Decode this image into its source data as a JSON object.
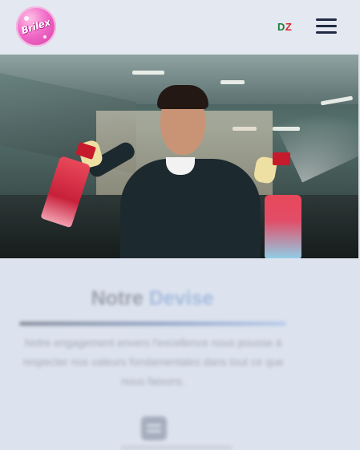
{
  "header": {
    "logo_text": "Brilex",
    "region": {
      "first": "D",
      "second": "Z"
    },
    "menu_icon": "hamburger-menu-icon"
  },
  "hero": {
    "image_alt": "Chef holding two Brilex spray bottles in a kitchen"
  },
  "section": {
    "title_main": "Notre",
    "title_accent": "Devise",
    "text": "Notre engagement envers l'excellence nous pousse à respecter nos valeurs fondamentales dans tout ce que nous faisons.",
    "feature_icon": "card-icon"
  },
  "colors": {
    "region_d": "#1b7f3a",
    "region_z": "#d8262c",
    "menu": "#1f2a44",
    "logo_pink": "#f06ac6",
    "accent_blue": "#3a6fbf"
  }
}
